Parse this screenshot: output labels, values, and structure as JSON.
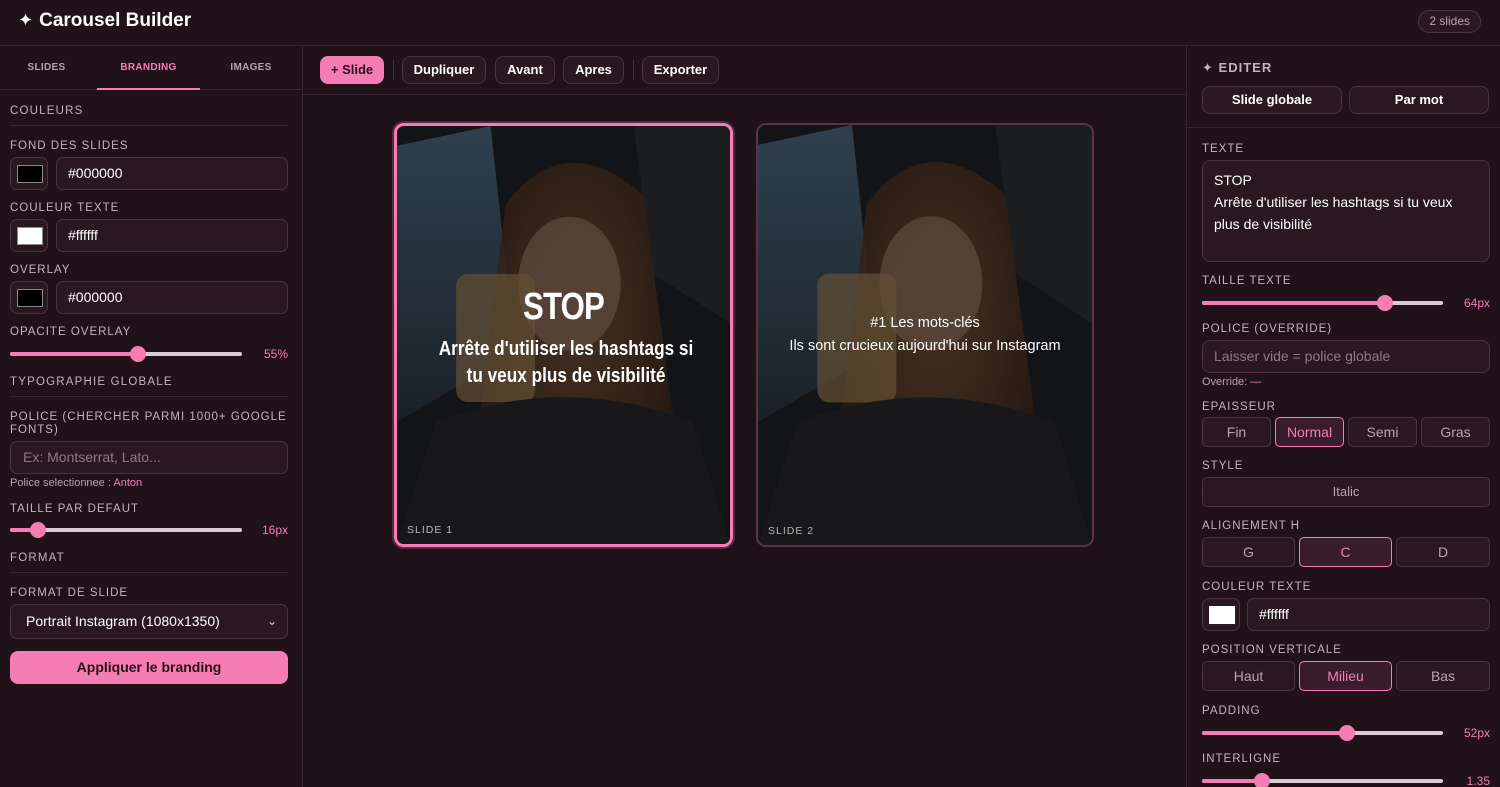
{
  "header": {
    "title": "Carousel Builder",
    "spark": "✦",
    "slide_count": "2 slides"
  },
  "left": {
    "tabs": [
      "SLIDES",
      "BRANDING",
      "IMAGES"
    ],
    "active_tab": "BRANDING",
    "section_colors": "COULEURS",
    "bg_label": "FOND DES SLIDES",
    "bg_value": "#000000",
    "text_color_label": "COULEUR TEXTE",
    "text_color_value": "#ffffff",
    "overlay_label": "OVERLAY",
    "overlay_value": "#000000",
    "overlay_opacity_label": "OPACITE OVERLAY",
    "overlay_opacity_value": "55%",
    "overlay_opacity_fraction": 0.55,
    "section_typo": "TYPOGRAPHIE GLOBALE",
    "font_label": "POLICE (CHERCHER PARMI 1000+ GOOGLE FONTS)",
    "font_placeholder": "Ex: Montserrat, Lato...",
    "font_selected_prefix": "Police selectionnee : ",
    "font_selected": "Anton",
    "default_size_label": "TAILLE PAR DEFAUT",
    "default_size_value": "16px",
    "default_size_fraction": 0.12,
    "section_format": "FORMAT",
    "slide_format_label": "FORMAT DE SLIDE",
    "slide_format_value": "Portrait Instagram (1080x1350)",
    "apply_label": "Appliquer le branding"
  },
  "toolbar": {
    "add_slide": "+ Slide",
    "duplicate": "Dupliquer",
    "before": "Avant",
    "after": "Apres",
    "export": "Exporter"
  },
  "slides": [
    {
      "number_label": "SLIDE 1",
      "headline": "STOP",
      "body": "Arrête d'utiliser les hashtags si tu veux plus de visibilité"
    },
    {
      "number_label": "SLIDE 2",
      "line1": "#1 Les mots-clés",
      "line2": "Ils sont crucieux aujourd'hui sur Instagram"
    }
  ],
  "right": {
    "title": "EDITER",
    "spark": "✦",
    "mode_global": "Slide globale",
    "mode_word": "Par mot",
    "text_label": "TEXTE",
    "text_value": "STOP\nArrête d'utiliser les hashtags si tu veux plus de visibilité",
    "size_label": "TAILLE TEXTE",
    "size_value": "64px",
    "size_fraction": 0.76,
    "font_override_label": "POLICE (OVERRIDE)",
    "font_override_placeholder": "Laisser vide = police globale",
    "override_prefix": "Override: ",
    "override_value": "—",
    "weight_label": "EPAISSEUR",
    "weights": [
      "Fin",
      "Normal",
      "Semi",
      "Gras"
    ],
    "weight_active": "Normal",
    "style_label": "STYLE",
    "style_italic": "Italic",
    "align_label": "ALIGNEMENT H",
    "aligns": [
      "G",
      "C",
      "D"
    ],
    "align_active": "C",
    "text_color_label": "COULEUR TEXTE",
    "text_color_value": "#ffffff",
    "vpos_label": "POSITION VERTICALE",
    "vpos": [
      "Haut",
      "Milieu",
      "Bas"
    ],
    "vpos_active": "Milieu",
    "padding_label": "PADDING",
    "padding_value": "52px",
    "padding_fraction": 0.6,
    "line_height_label": "INTERLIGNE",
    "line_height_value": "1.35",
    "line_height_fraction": 0.25
  },
  "colors": {
    "accent": "#f57db3",
    "background": "#1e1117",
    "panel": "#211219"
  }
}
